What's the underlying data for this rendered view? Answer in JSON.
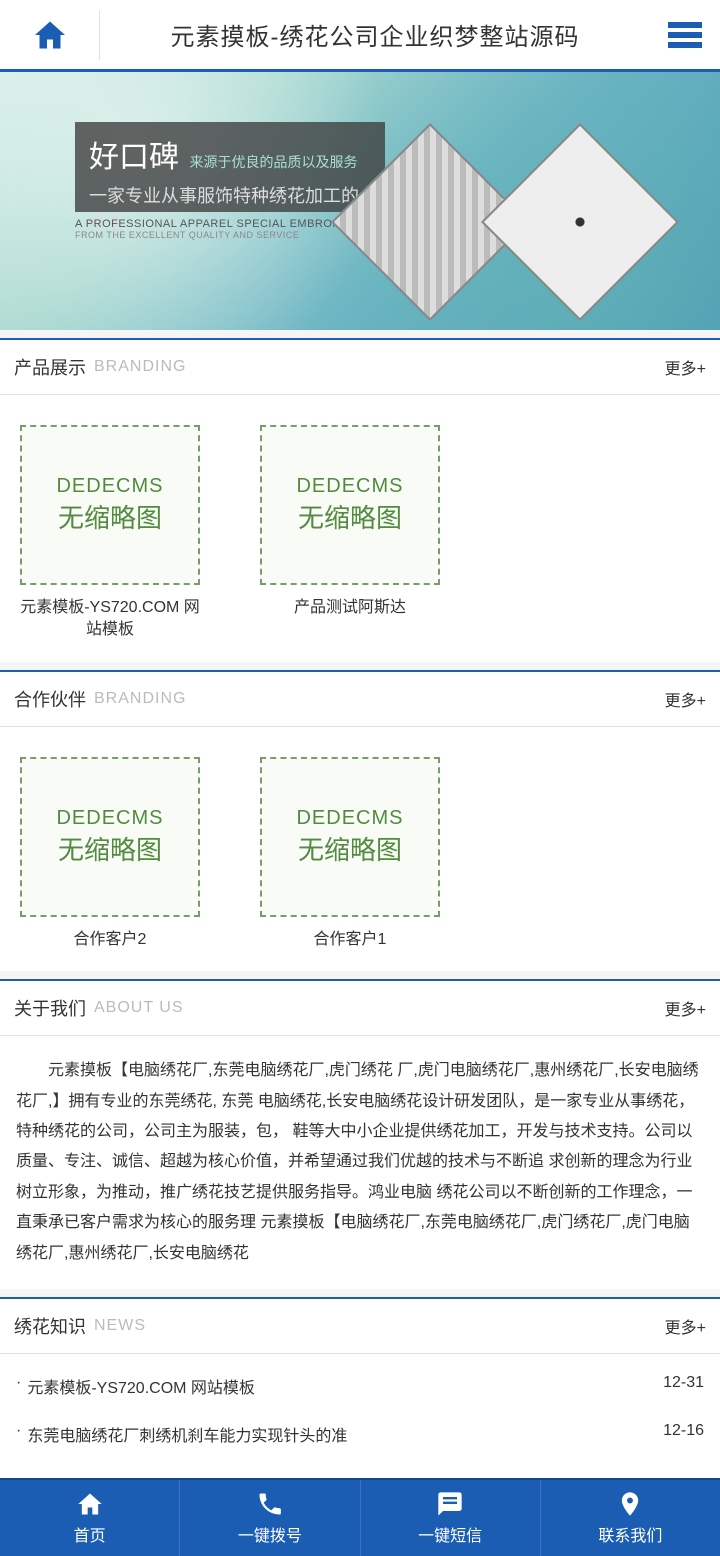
{
  "header": {
    "title": "元素摸板-绣花公司企业织梦整站源码"
  },
  "banner": {
    "title": "好口碑",
    "sub1": "来源于优良的品质以及服务",
    "sub2": "一家专业从事服饰特种绣花加工的企业",
    "eng1": "A PROFESSIONAL APPAREL SPECIAL EMBROIDERY PROCESSING ENTERPRISES",
    "eng2": "FROM THE EXCELLENT QUALITY AND SERVICE"
  },
  "sections": {
    "products": {
      "title_cn": "产品展示",
      "title_en": "BRANDING",
      "more": "更多+",
      "thumb1": "DEDECMS",
      "thumb2": "无缩略图",
      "items": [
        {
          "title": "元素模板-YS720.COM 网站模板"
        },
        {
          "title": "产品测试阿斯达"
        }
      ]
    },
    "partners": {
      "title_cn": "合作伙伴",
      "title_en": "BRANDING",
      "more": "更多+",
      "items": [
        {
          "title": "合作客户2"
        },
        {
          "title": "合作客户1"
        }
      ]
    },
    "about": {
      "title_cn": "关于我们",
      "title_en": "ABOUT US",
      "more": "更多+",
      "text": "元素摸板【电脑绣花厂,东莞电脑绣花厂,虎门绣花 厂,虎门电脑绣花厂,惠州绣花厂,长安电脑绣花厂,】拥有专业的东莞绣花, 东莞 电脑绣花,长安电脑绣花设计研发团队，是一家专业从事绣花，特种绣花的公司，公司主为服装，包， 鞋等大中小企业提供绣花加工，开发与技术支持。公司以 质量、专注、诚信、超越为核心价值，并希望通过我们优越的技术与不断追 求创新的理念为行业树立形象，为推动，推广绣花技艺提供服务指导。鸿业电脑 绣花公司以不断创新的工作理念，一直秉承已客户需求为核心的服务理 元素摸板【电脑绣花厂,东莞电脑绣花厂,虎门绣花厂,虎门电脑绣花厂,惠州绣花厂,长安电脑绣花"
    },
    "news": {
      "title_cn": "绣花知识",
      "title_en": "NEWS",
      "more": "更多+",
      "items": [
        {
          "title": "元素模板-YS720.COM 网站模板",
          "date": "12-31"
        },
        {
          "title": "东莞电脑绣花厂刺绣机刹车能力实现针头的准",
          "date": "12-16"
        }
      ]
    }
  },
  "bottom_nav": {
    "home": "首页",
    "dial": "一键拨号",
    "sms": "一键短信",
    "contact": "联系我们"
  }
}
